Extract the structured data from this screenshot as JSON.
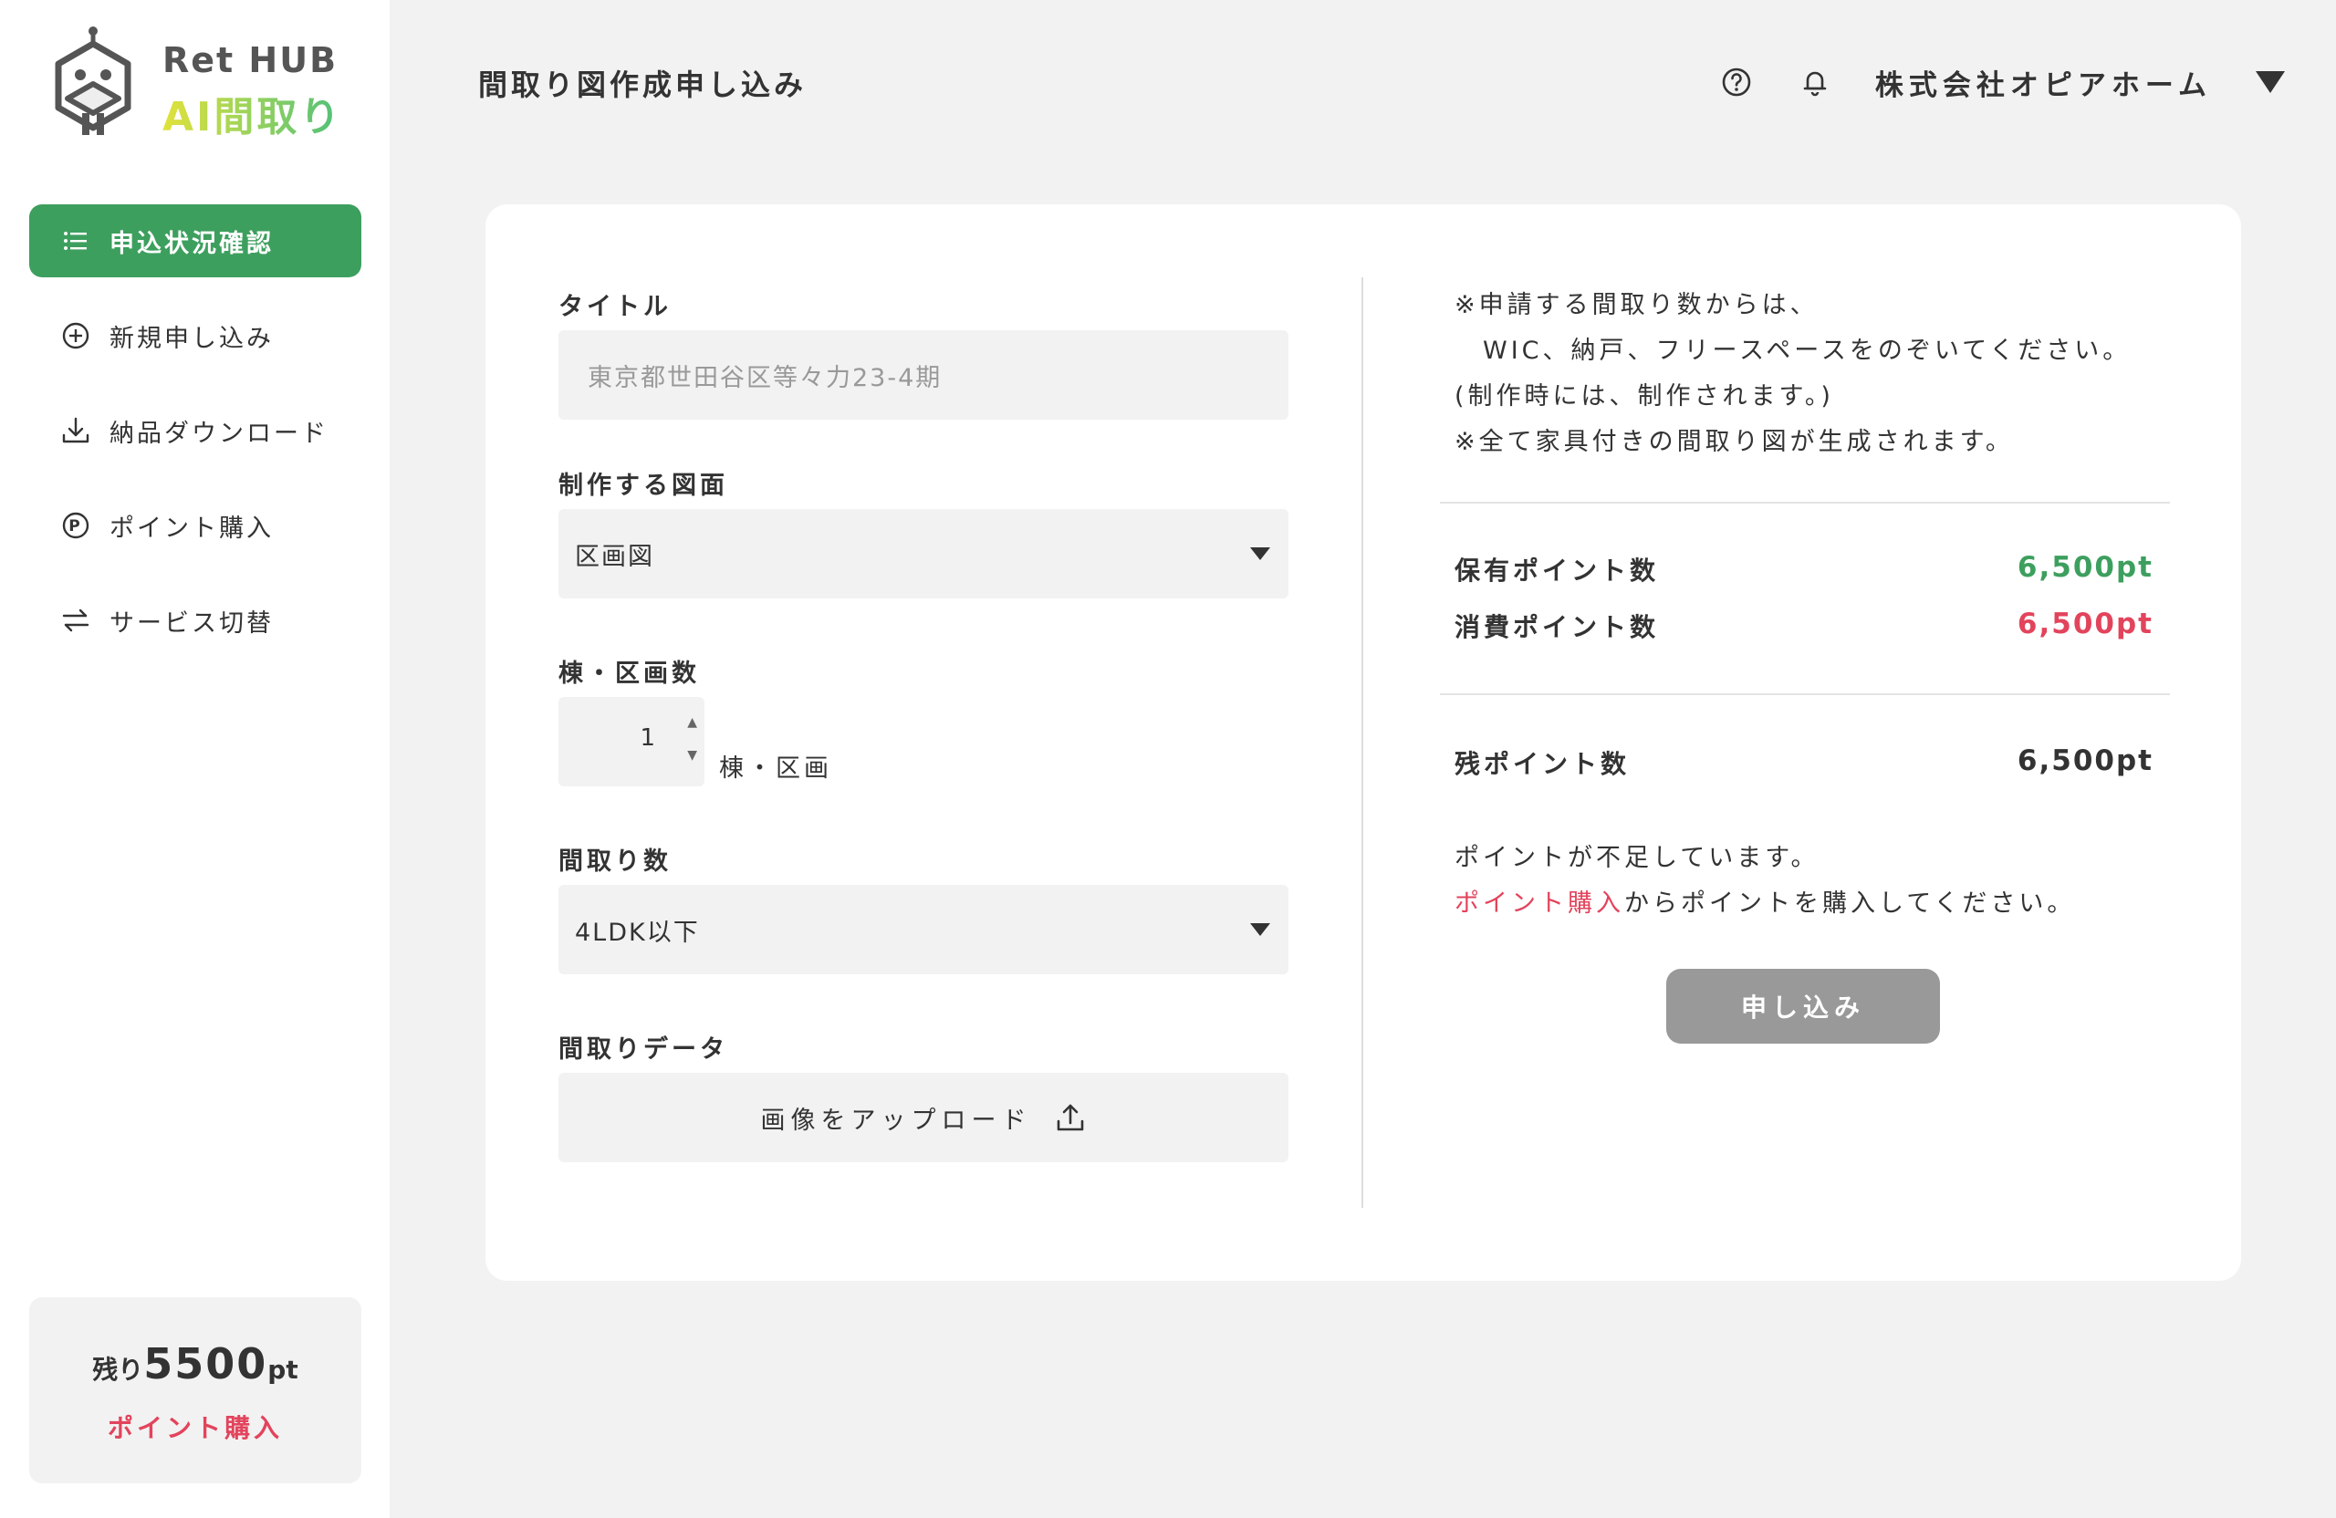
{
  "brand": {
    "line1": "Ret HUB",
    "line2": "AI間取り",
    "primary_color": "#3d9f5e",
    "accent_color": "#e2445c"
  },
  "sidebar": {
    "items": [
      {
        "label": "申込状況確認",
        "icon": "list-icon",
        "active": true
      },
      {
        "label": "新規申し込み",
        "icon": "plus-circle-icon",
        "active": false
      },
      {
        "label": "納品ダウンロード",
        "icon": "download-icon",
        "active": false
      },
      {
        "label": "ポイント購入",
        "icon": "points-icon",
        "active": false
      },
      {
        "label": "サービス切替",
        "icon": "switch-icon",
        "active": false
      }
    ],
    "points": {
      "prefix": "残り",
      "value": "5500",
      "unit": "pt",
      "buy_label": "ポイント購入"
    }
  },
  "header": {
    "title": "間取り図作成申し込み",
    "help_icon": "help-icon",
    "bell_icon": "bell-icon",
    "company": "株式会社オピアホーム"
  },
  "form": {
    "title_label": "タイトル",
    "title_placeholder": "東京都世田谷区等々力23-4期",
    "drawing_label": "制作する図面",
    "drawing_value": "区画図",
    "lots_label": "棟・区画数",
    "lots_value": "1",
    "lots_unit": "棟・区画",
    "rooms_label": "間取り数",
    "rooms_value": "4LDK以下",
    "data_label": "間取りデータ",
    "upload_label": "画像をアップロード"
  },
  "info": {
    "notes": [
      "※申請する間取り数からは、",
      "　WIC、納戸、フリースペースをのぞいてください。",
      "(制作時には、制作されます。)",
      "※全て家具付きの間取り図が生成されます。"
    ],
    "held_label": "保有ポイント数",
    "held_value": "6,500pt",
    "consumed_label": "消費ポイント数",
    "consumed_value": "6,500pt",
    "remaining_label": "残ポイント数",
    "remaining_value": "6,500pt",
    "warning_line1": "ポイントが不足しています。",
    "warning_link": "ポイント購入",
    "warning_line2_rest": "からポイントを購入してください。",
    "submit_label": "申し込み"
  }
}
